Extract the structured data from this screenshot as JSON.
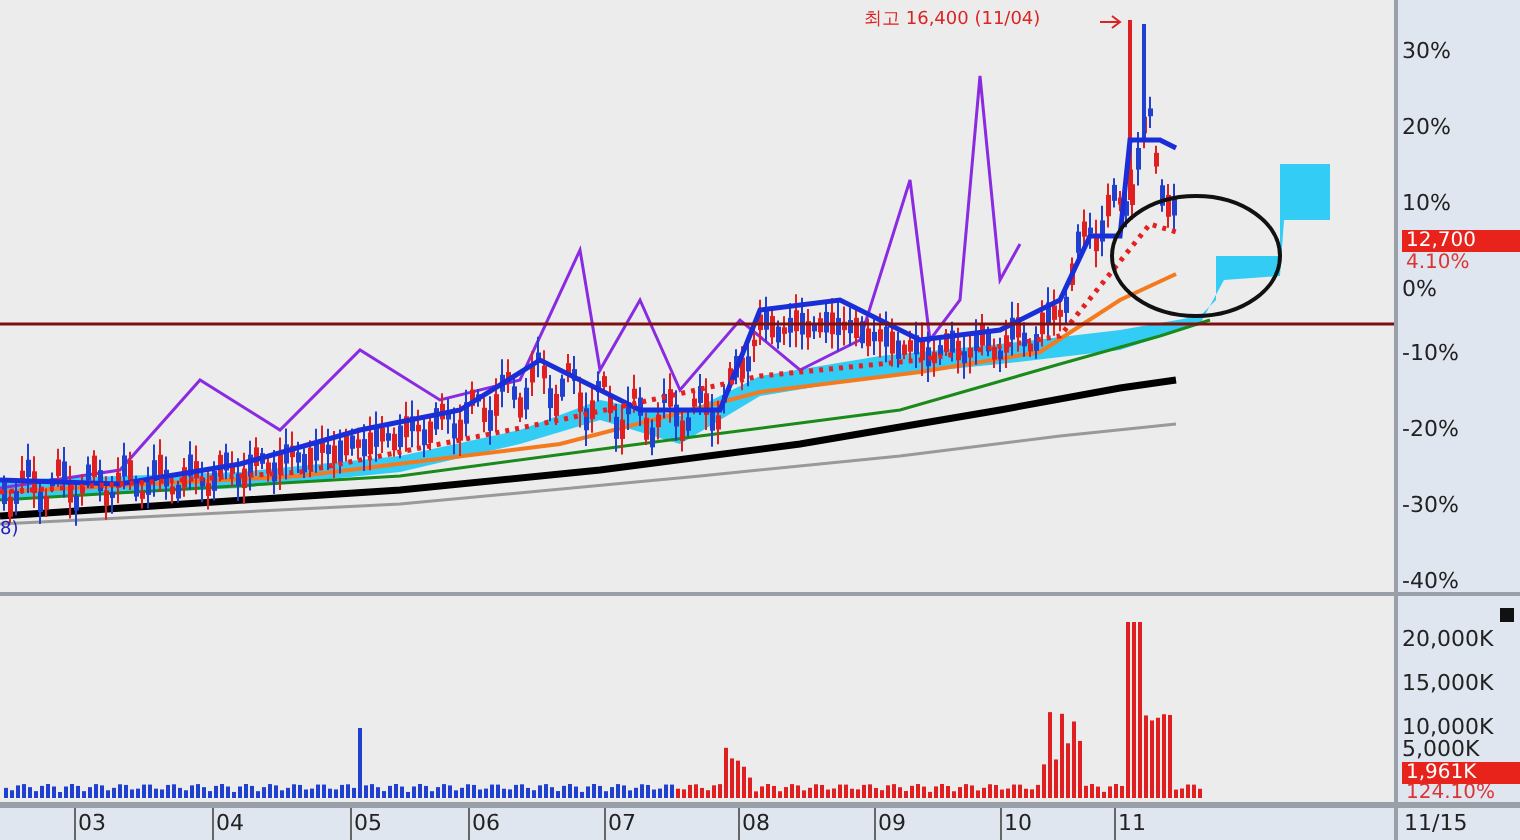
{
  "price_panel": {
    "high_label": "최고 16,400 (11/04)",
    "edge_label": "8)",
    "y_ticks": [
      "30%",
      "20%",
      "10%",
      "0%",
      "-10%",
      "-20%",
      "-30%",
      "-40%"
    ],
    "price_tag": "12,700",
    "change_tag": "4.10%"
  },
  "volume_panel": {
    "y_ticks": [
      "20,000K",
      "15,000K",
      "10,000K",
      "5,000K"
    ],
    "volume_tag": "1,961K",
    "change_tag": "124.10%"
  },
  "x_axis": {
    "months": [
      "03",
      "04",
      "05",
      "06",
      "07",
      "08",
      "09",
      "10",
      "11"
    ],
    "last_date": "11/15"
  }
}
